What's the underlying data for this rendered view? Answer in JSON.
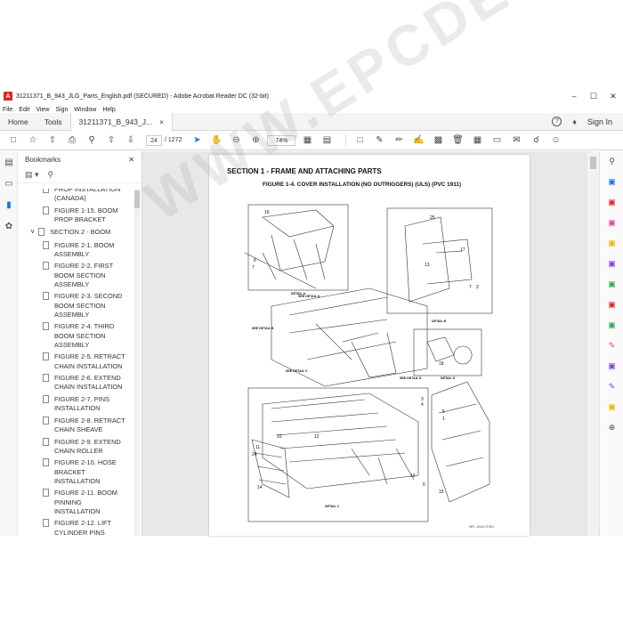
{
  "window": {
    "title": "31211371_B_943_JLG_Parts_English.pdf (SECURED) - Adobe Acrobat Reader DC (32-bit)",
    "controls": [
      "–",
      "☐",
      "✕"
    ]
  },
  "menu": [
    "File",
    "Edit",
    "View",
    "Sign",
    "Window",
    "Help"
  ],
  "tabs": {
    "home": "Home",
    "tools": "Tools",
    "doc": "31211371_B_943_J...",
    "doc_close": "×",
    "help": "?",
    "bell": "🔔",
    "sign_in": "Sign In"
  },
  "toolbar": {
    "page_current": "24",
    "page_total": "/ 1272",
    "zoom": "74%"
  },
  "bookmarks": {
    "title": "Bookmarks",
    "close": "✕",
    "items": [
      {
        "label": "PROP INSTALLATION (CANADA)",
        "type": "item"
      },
      {
        "label": "FIGURE 1-15. BOOM PROP BRACKET",
        "type": "item"
      },
      {
        "label": "SECTION 2 - BOOM",
        "type": "section"
      },
      {
        "label": "FIGURE 2-1. BOOM ASSEMBLY",
        "type": "item"
      },
      {
        "label": "FIGURE 2-2. FIRST BOOM SECTION ASSEMBLY",
        "type": "item"
      },
      {
        "label": "FIGURE 2-3. SECOND BOOM SECTION ASSEMBLY",
        "type": "item"
      },
      {
        "label": "FIGURE 2-4. THIRD BOOM SECTION ASSEMBLY",
        "type": "item"
      },
      {
        "label": "FIGURE 2-5. RETRACT CHAIN INSTALLATION",
        "type": "item"
      },
      {
        "label": "FIGURE 2-6. EXTEND CHAIN INSTALLATION",
        "type": "item"
      },
      {
        "label": "FIGURE 2-7. PINS INSTALLATION",
        "type": "item"
      },
      {
        "label": "FIGURE 2-8. RETRACT CHAIN SHEAVE",
        "type": "item"
      },
      {
        "label": "FIGURE 2-9. EXTEND CHAIN ROLLER",
        "type": "item"
      },
      {
        "label": "FIGURE 2-10. HOSE BRACKET INSTALLATION",
        "type": "item"
      },
      {
        "label": "FIGURE 2-11. BOOM PINNING INSTALLATION",
        "type": "item"
      },
      {
        "label": "FIGURE 2-12. LIFT CYLINDER PINS",
        "type": "item"
      }
    ]
  },
  "document": {
    "section_title": "SECTION 1 - FRAME AND ATTACHING PARTS",
    "figure_title": "FIGURE 1-4. COVER INSTALLATION (NO OUTRIGGERS) (ULS) (PVC 1911)",
    "figure_no": "MFL 1001179-RG",
    "detail_labels": [
      "DETAIL A",
      "DETAIL B",
      "DETAIL C",
      "DETAIL D",
      "SEE DETAIL A",
      "SEE DETAIL B",
      "SEE DETAIL C",
      "SEE DETAIL D"
    ],
    "callouts": [
      "16",
      "8",
      "7",
      "25",
      "13",
      "17",
      "7",
      "2",
      "18",
      "3",
      "4",
      "5",
      "1",
      "12",
      "10",
      "11",
      "24",
      "14",
      "12",
      "6",
      "15"
    ]
  },
  "watermark": "WWW.EPCDEPO.COM",
  "colors": {
    "accent": "#1473e6",
    "pdf_red": "#e0241b"
  }
}
